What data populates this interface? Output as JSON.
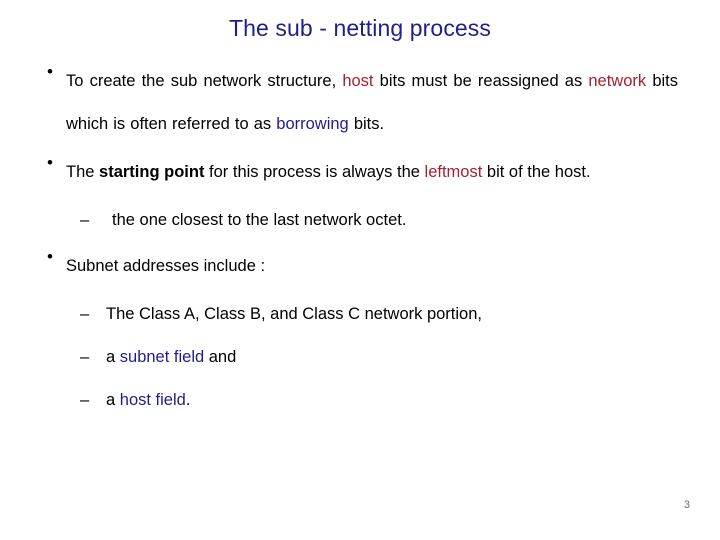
{
  "slide": {
    "title": "The sub - netting process",
    "page_number": "3",
    "colors": {
      "title": "#1f1f8c",
      "accent_red": "#a32330",
      "accent_navy": "#1f1f8c",
      "body_text": "#000000",
      "background": "#ffffff",
      "page_number": "#6b6b6b"
    },
    "bullet_marker": "•",
    "sub_bullet_marker": "–",
    "bullets": [
      {
        "marker": "•",
        "segments": [
          {
            "text": "To create the sub network structure, ",
            "style": "normal"
          },
          {
            "text": "host",
            "style": "red"
          },
          {
            "text": " bits must be reassigned as ",
            "style": "normal"
          },
          {
            "text": "network",
            "style": "red"
          },
          {
            "text": " bits which is often referred to as ",
            "style": "normal"
          },
          {
            "text": "borrowing",
            "style": "navy"
          },
          {
            "text": " bits.",
            "style": "normal"
          }
        ]
      },
      {
        "marker": "•",
        "segments": [
          {
            "text": "The ",
            "style": "normal"
          },
          {
            "text": "starting point",
            "style": "bold"
          },
          {
            "text": " for this process is always the ",
            "style": "normal"
          },
          {
            "text": "leftmost",
            "style": "red"
          },
          {
            "text": " bit of the host.",
            "style": "normal"
          }
        ]
      },
      {
        "marker": "–",
        "segments": [
          {
            "text": "the one closest to the last network octet.",
            "style": "normal"
          }
        ]
      },
      {
        "marker": "•",
        "segments": [
          {
            "text": "Subnet addresses include :",
            "style": "normal"
          }
        ]
      },
      {
        "marker": "–",
        "segments": [
          {
            "text": "The Class A, Class B, and Class C network portion,",
            "style": "normal"
          }
        ]
      },
      {
        "marker": "–",
        "segments": [
          {
            "text": "a ",
            "style": "normal"
          },
          {
            "text": "subnet field",
            "style": "navy"
          },
          {
            "text": " and",
            "style": "normal"
          }
        ]
      },
      {
        "marker": "–",
        "segments": [
          {
            "text": "a ",
            "style": "normal"
          },
          {
            "text": "host field",
            "style": "navy"
          },
          {
            "text": ".",
            "style": "normal"
          }
        ]
      }
    ]
  }
}
